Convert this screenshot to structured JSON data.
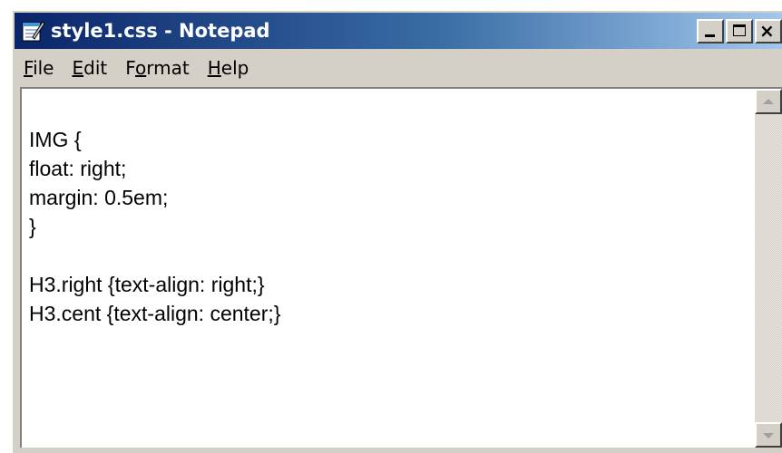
{
  "window": {
    "title": "style1.css - Notepad",
    "app_icon": "notepad-icon"
  },
  "title_buttons": {
    "minimize": "minimize-icon",
    "maximize": "maximize-icon",
    "close": "close-icon",
    "close_glyph": "×"
  },
  "menu": {
    "items": [
      {
        "label_first": "F",
        "label_rest": "ile"
      },
      {
        "label_first": "E",
        "label_rest": "dit"
      },
      {
        "label_first": "F",
        "label_rest": "ormat",
        "prefix": "F",
        "accel": "o",
        "suffix": "rmat"
      },
      {
        "label_first": "H",
        "label_rest": "elp"
      }
    ]
  },
  "editor": {
    "lines": [
      "IMG {",
      "float: right;",
      "margin: 0.5em;",
      "}",
      "",
      "H3.right {text-align: right;}",
      "H3.cent {text-align: center;}"
    ]
  },
  "colors": {
    "title_active_start": "#0a246a",
    "title_active_end": "#a6caf0",
    "face": "#d4d0c8"
  }
}
